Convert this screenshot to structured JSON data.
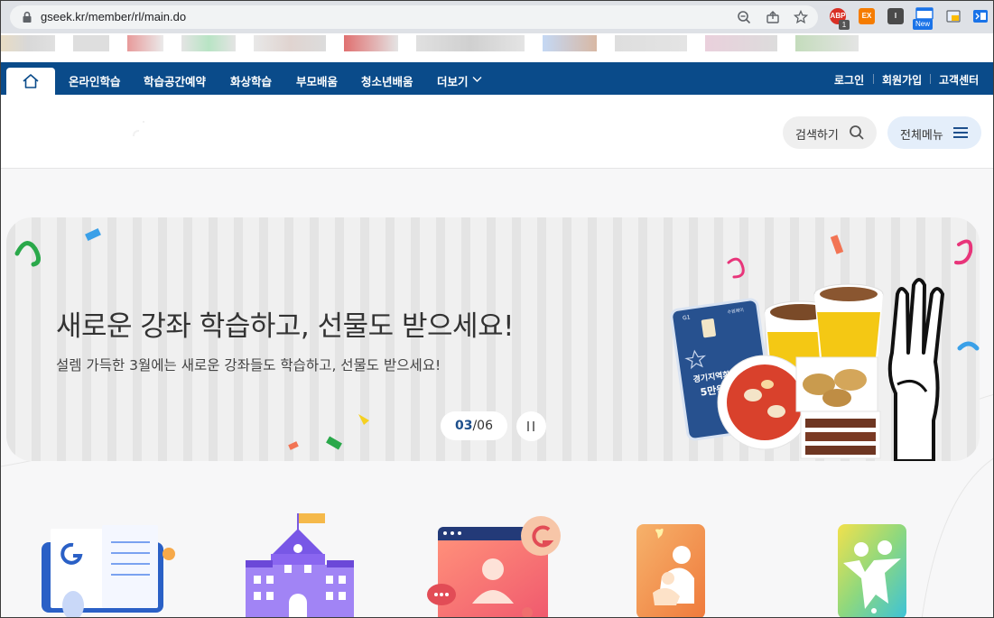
{
  "browser": {
    "url": "gseek.kr/member/rl/main.do",
    "ext_badge": "1",
    "new_badge": "New",
    "ext_abp_label": "ABP",
    "ext_ex_label": "EX",
    "ext_i_label": "I"
  },
  "nav": {
    "items": [
      "온라인학습",
      "학습공간예약",
      "화상학습",
      "부모배움",
      "청소년배움",
      "더보기"
    ],
    "right": [
      "로그인",
      "회원가입",
      "고객센터"
    ]
  },
  "header": {
    "search_label": "검색하기",
    "menu_label": "전체메뉴"
  },
  "hero": {
    "title": "새로운 강좌 학습하고, 선물도 받으세요!",
    "subtitle": "설렘 가득한 3월에는 새로운 강좌들도 학습하고, 선물도 받으세요!",
    "slide_current": "03",
    "slide_total": "/06",
    "card_label": "경기지역화폐",
    "card_amount": "5만원권",
    "card_logo": "G1",
    "card_corner": "수원페이"
  },
  "colors": {
    "nav_bg": "#0a4b8a",
    "accent": "#1d4f8c"
  }
}
